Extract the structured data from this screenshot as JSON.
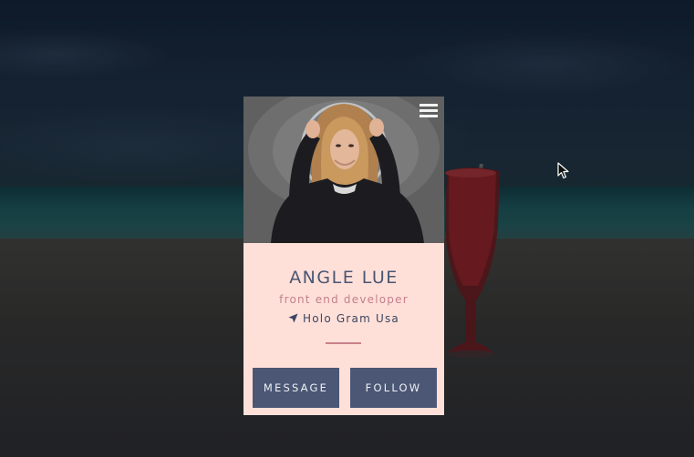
{
  "profile": {
    "name": "ANGLE LUE",
    "role": "front end developer",
    "location": "Holo Gram Usa"
  },
  "actions": {
    "message_label": "MESSAGE",
    "follow_label": "FOLLOW"
  },
  "icons": {
    "menu": "hamburger-menu-icon",
    "location": "location-arrow-icon",
    "cursor": "mouse-pointer-icon"
  },
  "colors": {
    "card_background": "#ffe0d9",
    "name_text": "#4a5572",
    "role_text": "#c3808a",
    "divider": "#c9808a",
    "button_background": "#4b5775",
    "button_text": "#eef0f4"
  }
}
